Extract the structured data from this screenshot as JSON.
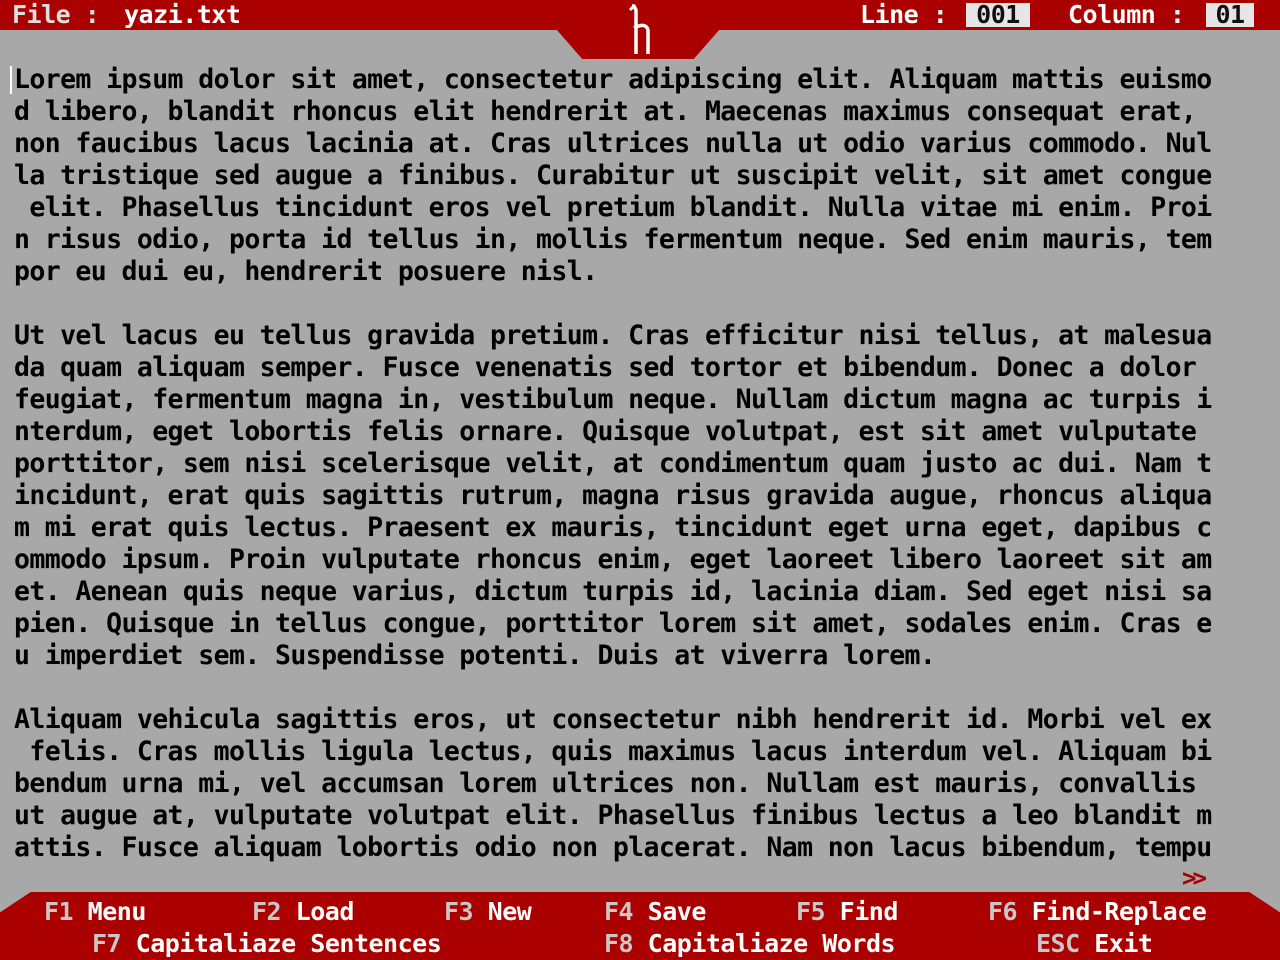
{
  "header": {
    "file_label": "File :",
    "file_name": "yazi.txt",
    "line_label": "Line :",
    "line_value": "001",
    "column_label": "Column :",
    "column_value": "01",
    "logo_icon": "h-glyph-logo-icon"
  },
  "editor": {
    "paragraphs": [
      [
        "Lorem ipsum dolor sit amet, consectetur adipiscing elit. Aliquam mattis euismo",
        "d libero, blandit rhoncus elit hendrerit at. Maecenas maximus consequat erat,",
        "non faucibus lacus lacinia at. Cras ultrices nulla ut odio varius commodo. Nul",
        "la tristique sed augue a finibus. Curabitur ut suscipit velit, sit amet congue",
        " elit. Phasellus tincidunt eros vel pretium blandit. Nulla vitae mi enim. Proi",
        "n risus odio, porta id tellus in, mollis fermentum neque. Sed enim mauris, tem",
        "por eu dui eu, hendrerit posuere nisl."
      ],
      [
        "Ut vel lacus eu tellus gravida pretium. Cras efficitur nisi tellus, at malesua",
        "da quam aliquam semper. Fusce venenatis sed tortor et bibendum. Donec a dolor",
        "feugiat, fermentum magna in, vestibulum neque. Nullam dictum magna ac turpis i",
        "nterdum, eget lobortis felis ornare. Quisque volutpat, est sit amet vulputate",
        "porttitor, sem nisi scelerisque velit, at condimentum quam justo ac dui. Nam t",
        "incidunt, erat quis sagittis rutrum, magna risus gravida augue, rhoncus aliqua",
        "m mi erat quis lectus. Praesent ex mauris, tincidunt eget urna eget, dapibus c",
        "ommodo ipsum. Proin vulputate rhoncus enim, eget laoreet libero laoreet sit am",
        "et. Aenean quis neque varius, dictum turpis id, lacinia diam. Sed eget nisi sa",
        "pien. Quisque in tellus congue, porttitor lorem sit amet, sodales enim. Cras e",
        "u imperdiet sem. Suspendisse potenti. Duis at viverra lorem."
      ],
      [
        "Aliquam vehicula sagittis eros, ut consectetur nibh hendrerit id. Morbi vel ex",
        " felis. Cras mollis ligula lectus, quis maximus lacus interdum vel. Aliquam bi",
        "bendum urna mi, vel accumsan lorem ultrices non. Nullam est mauris, convallis",
        "ut augue at, vulputate volutpat elit. Phasellus finibus lectus a leo blandit m",
        "attis. Fusce aliquam lobortis odio non placerat. Nam non lacus bibendum, tempu"
      ]
    ],
    "more_indicator": ">>"
  },
  "footer": {
    "keys": [
      {
        "key": "F1",
        "label": "Menu"
      },
      {
        "key": "F2",
        "label": "Load"
      },
      {
        "key": "F3",
        "label": "New"
      },
      {
        "key": "F4",
        "label": "Save"
      },
      {
        "key": "F5",
        "label": "Find"
      },
      {
        "key": "F6",
        "label": "Find-Replace"
      },
      {
        "key": "F7",
        "label": "Capitaliaze Sentences"
      },
      {
        "key": "F8",
        "label": "Capitaliaze Words"
      },
      {
        "key": "ESC",
        "label": "Exit"
      }
    ]
  },
  "colors": {
    "bar_red": "#aa0000",
    "editor_bg": "#a8a8a8",
    "text": "#000000",
    "value_box": "#e6e6e6"
  }
}
